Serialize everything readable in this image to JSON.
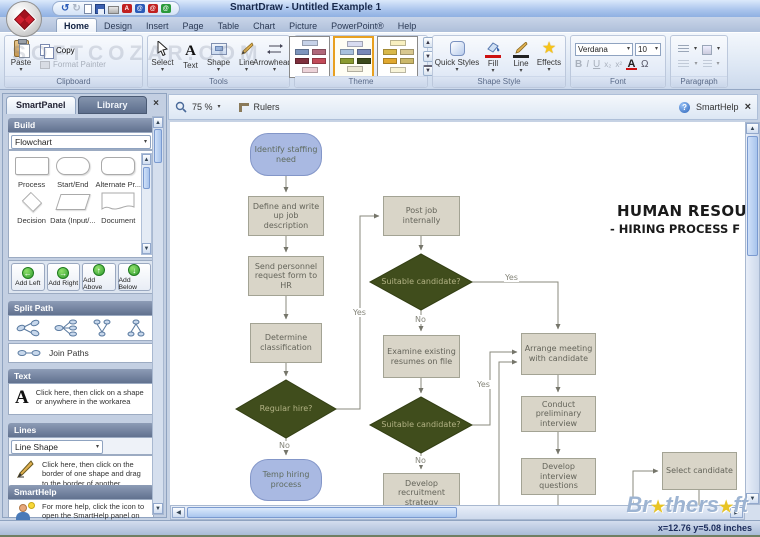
{
  "window": {
    "title": "SmartDraw - Untitled Example 1"
  },
  "tabs": [
    "Home",
    "Design",
    "Insert",
    "Page",
    "Table",
    "Chart",
    "Picture",
    "PowerPoint®",
    "Help"
  ],
  "ribbon": {
    "clipboard": {
      "label": "Clipboard",
      "paste": "Paste",
      "copy": "Copy",
      "format_painter": "Format Painter"
    },
    "tools": {
      "label": "Tools",
      "select": "Select",
      "text": "Text",
      "shape": "Shape",
      "line": "Line",
      "arrowheads": "Arrowheads"
    },
    "theme": {
      "label": "Theme",
      "swatches": [
        {
          "colors": [
            "#c6d2e8",
            "#7d95bd",
            "#b0687a",
            "#7e2f3c",
            "#c24a58",
            "#ecd2d8"
          ]
        },
        {
          "colors": [
            "#d8dcf0",
            "#a8c0dc",
            "#7888b8",
            "#8a9a30",
            "#3c4a1a",
            "#ece8d4"
          ]
        },
        {
          "colors": [
            "#f8f0c0",
            "#d8b84a",
            "#d8c890",
            "#e0a830",
            "#cbb86a",
            "#f8f4d8"
          ]
        }
      ]
    },
    "shape_style": {
      "label": "Shape Style",
      "quick_styles": "Quick Styles",
      "fill": "Fill",
      "line": "Line",
      "effects": "Effects"
    },
    "font": {
      "label": "Font",
      "family": "Verdana",
      "size": "10",
      "bold": "B",
      "italic": "I",
      "underline": "U",
      "sub": "x₂",
      "sup": "x²",
      "color": "A",
      "symbol": "Ω"
    },
    "paragraph": {
      "label": "Paragraph"
    }
  },
  "panel": {
    "tabs": {
      "smartpanel": "SmartPanel",
      "library": "Library"
    },
    "close": "×",
    "build": {
      "title": "Build",
      "dropdown": "Flowchart",
      "shapes": [
        "Process",
        "Start/End",
        "Alternate Pr...",
        "Decision",
        "Data (Input/...",
        "Document"
      ],
      "buttons": [
        "Add Left",
        "Add Right",
        "Add Above",
        "Add Below"
      ]
    },
    "split": {
      "title": "Split Path",
      "join": "Join Paths"
    },
    "text": {
      "title": "Text",
      "caption": "Click here, then click on a shape or anywhere in the workarea"
    },
    "lines": {
      "title": "Lines",
      "dropdown": "Line Shape",
      "caption": "Click here, then click on the border of one shape and drag to the border of another."
    },
    "smarthelp": {
      "title": "SmartHelp",
      "caption": "For more help, click the icon to open the SmartHelp panel on the"
    }
  },
  "canvas_toolbar": {
    "zoom": "75 %",
    "rulers": "Rulers",
    "smarthelp": "SmartHelp",
    "close": "×"
  },
  "flowchart": {
    "title": {
      "line1": "HUMAN RESOUR",
      "line2": "- HIRING PROCESS F"
    },
    "colors": {
      "process_fill": "#d9d5c8",
      "terminator_fill": "#a9b9e2",
      "decision_fill": "#404d1c",
      "connector": "#8a8a7c"
    },
    "nodes": {
      "identify": {
        "label": "Identify staffing need"
      },
      "define": {
        "label": "Define and write up job description"
      },
      "send": {
        "label": "Send personnel request form to HR"
      },
      "determine": {
        "label": "Determine classification"
      },
      "regular": {
        "label": "Regular hire?"
      },
      "temp": {
        "label": "Temp hiring process"
      },
      "post": {
        "label": "Post job internally"
      },
      "suitable1": {
        "label": "Suitable candidate?"
      },
      "examine": {
        "label": "Examine existing resumes on file"
      },
      "suitable2": {
        "label": "Suitable candidate?"
      },
      "develop_recruitment": {
        "label": "Develop recruitment strategy"
      },
      "arrange": {
        "label": "Arrange meeting with candidate"
      },
      "conduct": {
        "label": "Conduct preliminary interview"
      },
      "develop_questions": {
        "label": "Develop interview questions"
      },
      "select": {
        "label": "Select candidate"
      }
    },
    "edge_labels": {
      "regular_yes": "Yes",
      "regular_no": "No",
      "s1_yes": "Yes",
      "s1_no": "No",
      "s2_yes": "Yes",
      "s2_no": "No"
    }
  },
  "statusbar": {
    "coords": "x=12.76  y=5.08 inches"
  },
  "watermarks": {
    "ribbon": "SOFTCOZAR.COM",
    "brand_p1": "Br",
    "brand_star": "★",
    "brand_p2": "thers",
    "brand_p3": "ft"
  }
}
